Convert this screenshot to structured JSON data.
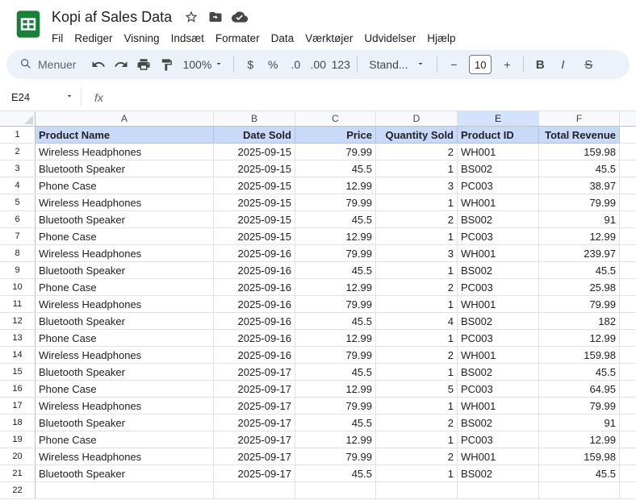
{
  "app": {
    "title": "Kopi af Sales Data",
    "menus": [
      "Fil",
      "Rediger",
      "Visning",
      "Indsæt",
      "Formater",
      "Data",
      "Værktøjer",
      "Udvidelser",
      "Hjælp"
    ]
  },
  "icons": {
    "logo": "sheets-grid-logo",
    "star": "star-outline",
    "move": "move-to-folder",
    "cloud": "cloud-saved-check",
    "search": "magnifier",
    "undo": "curved-arrow-left",
    "redo": "curved-arrow-right",
    "print": "printer",
    "paint": "paint-roller",
    "caret": "triangle-down"
  },
  "toolbar": {
    "menus_label": "Menuer",
    "zoom": "100%",
    "currency": "$",
    "percent": "%",
    "decrease_decimal": ".0",
    "increase_decimal": ".00",
    "more_formats": "123",
    "font": "Stand...",
    "decrease_font": "−",
    "font_size": "10",
    "increase_font": "+",
    "bold": "B",
    "italic": "I",
    "strikethrough": "S"
  },
  "formula_bar": {
    "name_box": "E24",
    "fx": "fx"
  },
  "grid": {
    "column_letters": [
      "A",
      "B",
      "C",
      "D",
      "E",
      "F"
    ],
    "selected_column": "E",
    "header_row": [
      "Product Name",
      "Date Sold",
      "Price",
      "Quantity Sold",
      "Product ID",
      "Total Revenue"
    ],
    "rows": [
      [
        "Wireless Headphones",
        "2025-09-15",
        "79.99",
        "2",
        "WH001",
        "159.98"
      ],
      [
        "Bluetooth Speaker",
        "2025-09-15",
        "45.5",
        "1",
        "BS002",
        "45.5"
      ],
      [
        "Phone Case",
        "2025-09-15",
        "12.99",
        "3",
        "PC003",
        "38.97"
      ],
      [
        "Wireless Headphones",
        "2025-09-15",
        "79.99",
        "1",
        "WH001",
        "79.99"
      ],
      [
        "Bluetooth Speaker",
        "2025-09-15",
        "45.5",
        "2",
        "BS002",
        "91"
      ],
      [
        "Phone Case",
        "2025-09-15",
        "12.99",
        "1",
        "PC003",
        "12.99"
      ],
      [
        "Wireless Headphones",
        "2025-09-16",
        "79.99",
        "3",
        "WH001",
        "239.97"
      ],
      [
        "Bluetooth Speaker",
        "2025-09-16",
        "45.5",
        "1",
        "BS002",
        "45.5"
      ],
      [
        "Phone Case",
        "2025-09-16",
        "12.99",
        "2",
        "PC003",
        "25.98"
      ],
      [
        "Wireless Headphones",
        "2025-09-16",
        "79.99",
        "1",
        "WH001",
        "79.99"
      ],
      [
        "Bluetooth Speaker",
        "2025-09-16",
        "45.5",
        "4",
        "BS002",
        "182"
      ],
      [
        "Phone Case",
        "2025-09-16",
        "12.99",
        "1",
        "PC003",
        "12.99"
      ],
      [
        "Wireless Headphones",
        "2025-09-16",
        "79.99",
        "2",
        "WH001",
        "159.98"
      ],
      [
        "Bluetooth Speaker",
        "2025-09-17",
        "45.5",
        "1",
        "BS002",
        "45.5"
      ],
      [
        "Phone Case",
        "2025-09-17",
        "12.99",
        "5",
        "PC003",
        "64.95"
      ],
      [
        "Wireless Headphones",
        "2025-09-17",
        "79.99",
        "1",
        "WH001",
        "79.99"
      ],
      [
        "Bluetooth Speaker",
        "2025-09-17",
        "45.5",
        "2",
        "BS002",
        "91"
      ],
      [
        "Phone Case",
        "2025-09-17",
        "12.99",
        "1",
        "PC003",
        "12.99"
      ],
      [
        "Wireless Headphones",
        "2025-09-17",
        "79.99",
        "2",
        "WH001",
        "159.98"
      ],
      [
        "Bluetooth Speaker",
        "2025-09-17",
        "45.5",
        "1",
        "BS002",
        "45.5"
      ]
    ],
    "first_data_row": 2,
    "empty_row_number": 22
  },
  "colors": {
    "logo_green": "#188038",
    "toolbar_bg": "#edf2fa",
    "header_row_bg": "#c9daf8",
    "selected_col_bg": "#d3e3fd"
  }
}
